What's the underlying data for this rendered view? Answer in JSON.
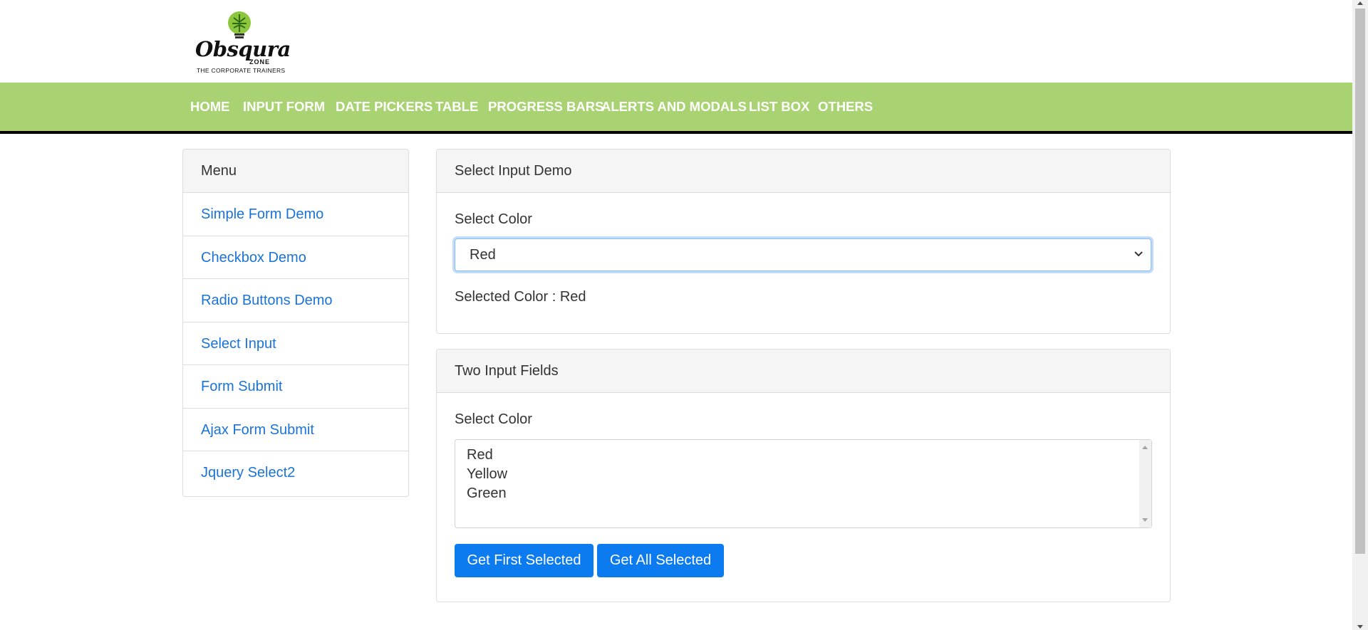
{
  "brand": {
    "logo_word": "Obsqura",
    "logo_sub": "ZONE",
    "logo_tagline": "THE CORPORATE TRAINERS",
    "accent_green": "#a9d372",
    "link_blue": "#1a73d8",
    "button_blue": "#0d7bf0"
  },
  "nav": {
    "items": [
      "HOME",
      "INPUT FORM",
      "DATE PICKERS",
      "TABLE",
      "PROGRESS BARS",
      "ALERTS AND MODALS",
      "LIST BOX",
      "OTHERS"
    ]
  },
  "sidebar": {
    "title": "Menu",
    "items": [
      "Simple Form Demo",
      "Checkbox Demo",
      "Radio Buttons Demo",
      "Select Input",
      "Form Submit",
      "Ajax Form Submit",
      "Jquery Select2"
    ]
  },
  "select_demo": {
    "title": "Select Input Demo",
    "label": "Select Color",
    "selected_value": "Red",
    "result_text": "Selected Color : Red"
  },
  "multi_demo": {
    "title": "Two Input Fields",
    "label": "Select Color",
    "options": [
      "Red",
      "Yellow",
      "Green"
    ],
    "buttons": [
      "Get First Selected",
      "Get All Selected"
    ]
  }
}
